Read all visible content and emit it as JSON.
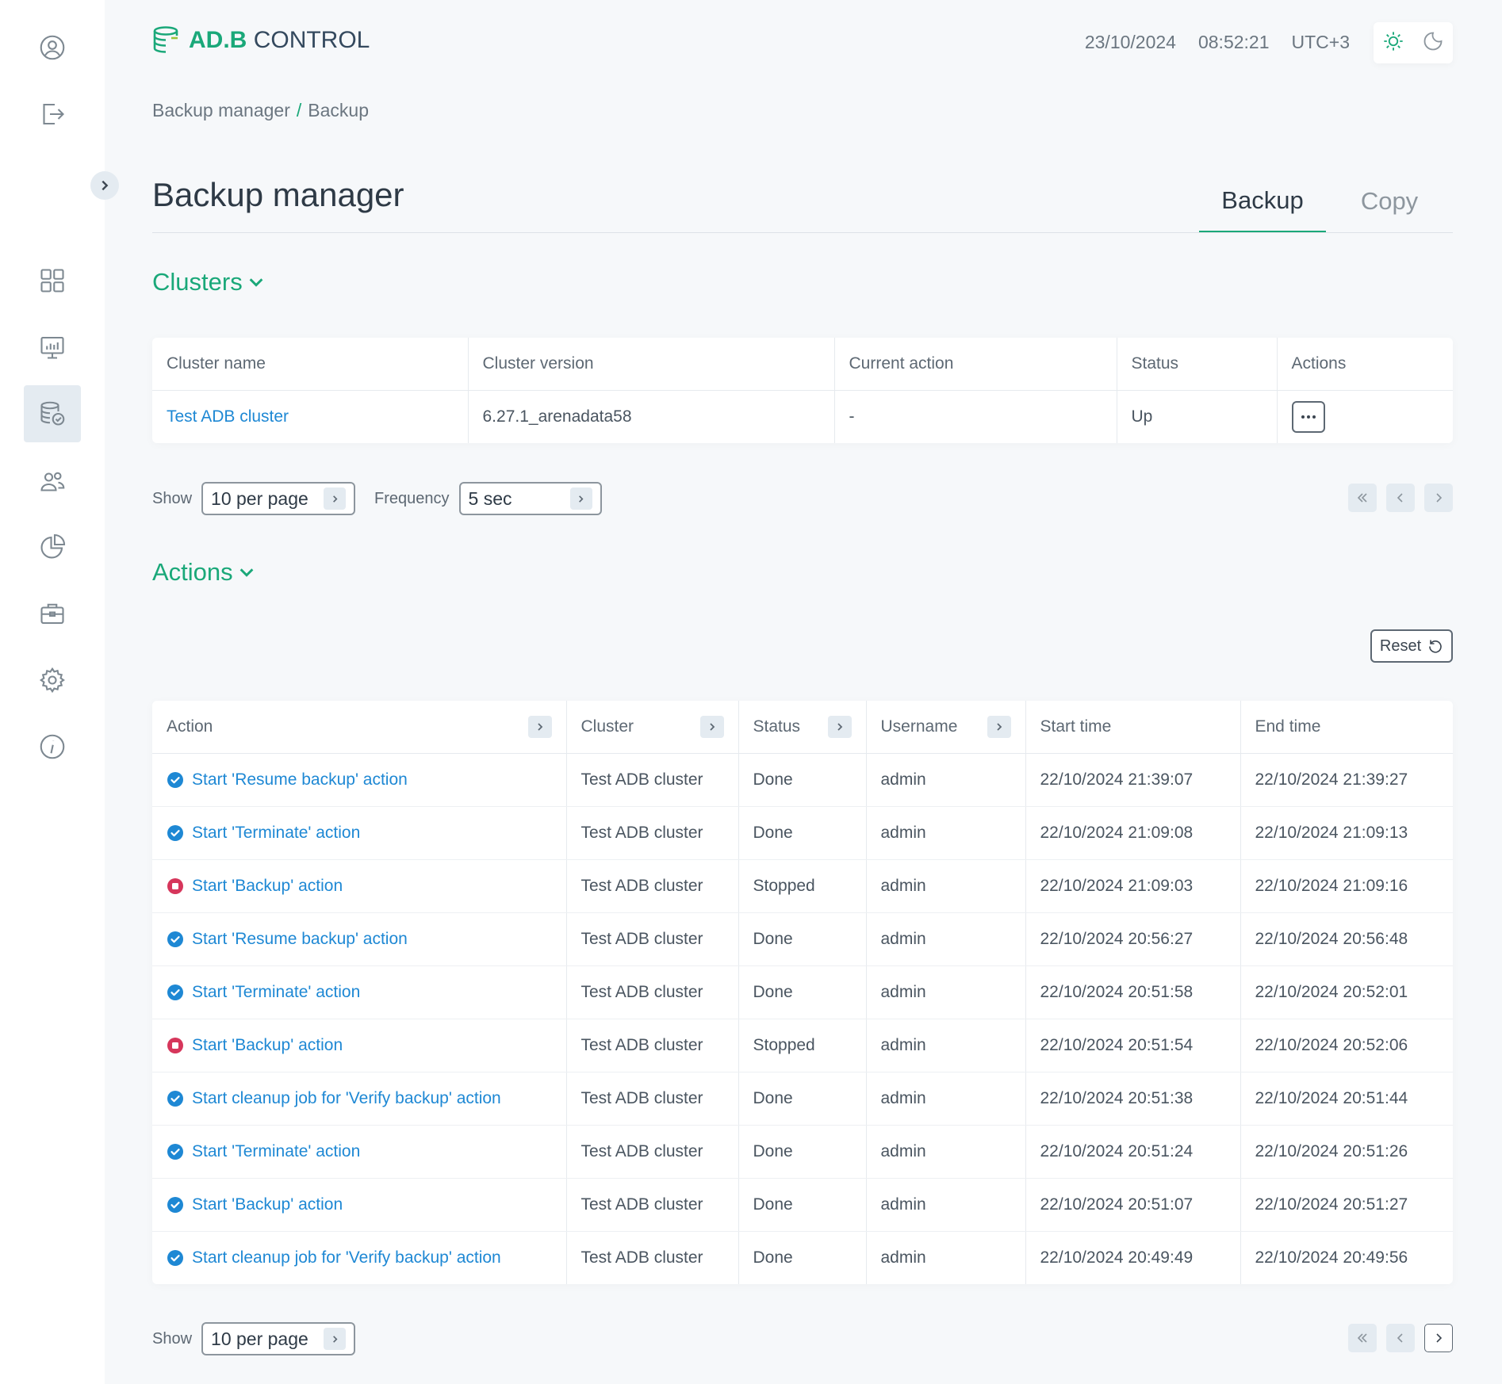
{
  "app": {
    "logo_brand": "AD.B",
    "logo_product": "CONTROL",
    "date": "23/10/2024",
    "time": "08:52:21",
    "timezone": "UTC+3"
  },
  "breadcrumb": {
    "parent": "Backup manager",
    "separator": "/",
    "current": "Backup"
  },
  "page": {
    "title": "Backup manager"
  },
  "tabs": [
    {
      "label": "Backup"
    },
    {
      "label": "Copy"
    }
  ],
  "clusters": {
    "title": "Clusters",
    "columns": [
      "Cluster name",
      "Cluster version",
      "Current action",
      "Status",
      "Actions"
    ],
    "rows": [
      {
        "name": "Test ADB cluster",
        "version": "6.27.1_arenadata58",
        "current_action": "-",
        "status": "Up"
      }
    ],
    "show_label": "Show",
    "per_page": "10 per page",
    "frequency_label": "Frequency",
    "frequency": "5 sec"
  },
  "actions": {
    "title": "Actions",
    "reset_label": "Reset",
    "columns": [
      "Action",
      "Cluster",
      "Status",
      "Username",
      "Start time",
      "End time"
    ],
    "rows": [
      {
        "action": "Start 'Resume backup' action",
        "cluster": "Test ADB cluster",
        "status": "Done",
        "username": "admin",
        "start": "22/10/2024 21:39:07",
        "end": "22/10/2024 21:39:27",
        "state": "done"
      },
      {
        "action": "Start 'Terminate' action",
        "cluster": "Test ADB cluster",
        "status": "Done",
        "username": "admin",
        "start": "22/10/2024 21:09:08",
        "end": "22/10/2024 21:09:13",
        "state": "done"
      },
      {
        "action": "Start 'Backup' action",
        "cluster": "Test ADB cluster",
        "status": "Stopped",
        "username": "admin",
        "start": "22/10/2024 21:09:03",
        "end": "22/10/2024 21:09:16",
        "state": "stopped"
      },
      {
        "action": "Start 'Resume backup' action",
        "cluster": "Test ADB cluster",
        "status": "Done",
        "username": "admin",
        "start": "22/10/2024 20:56:27",
        "end": "22/10/2024 20:56:48",
        "state": "done"
      },
      {
        "action": "Start 'Terminate' action",
        "cluster": "Test ADB cluster",
        "status": "Done",
        "username": "admin",
        "start": "22/10/2024 20:51:58",
        "end": "22/10/2024 20:52:01",
        "state": "done"
      },
      {
        "action": "Start 'Backup' action",
        "cluster": "Test ADB cluster",
        "status": "Stopped",
        "username": "admin",
        "start": "22/10/2024 20:51:54",
        "end": "22/10/2024 20:52:06",
        "state": "stopped"
      },
      {
        "action": "Start cleanup job for 'Verify backup' action",
        "cluster": "Test ADB cluster",
        "status": "Done",
        "username": "admin",
        "start": "22/10/2024 20:51:38",
        "end": "22/10/2024 20:51:44",
        "state": "done"
      },
      {
        "action": "Start 'Terminate' action",
        "cluster": "Test ADB cluster",
        "status": "Done",
        "username": "admin",
        "start": "22/10/2024 20:51:24",
        "end": "22/10/2024 20:51:26",
        "state": "done"
      },
      {
        "action": "Start 'Backup' action",
        "cluster": "Test ADB cluster",
        "status": "Done",
        "username": "admin",
        "start": "22/10/2024 20:51:07",
        "end": "22/10/2024 20:51:27",
        "state": "done"
      },
      {
        "action": "Start cleanup job for 'Verify backup' action",
        "cluster": "Test ADB cluster",
        "status": "Done",
        "username": "admin",
        "start": "22/10/2024 20:49:49",
        "end": "22/10/2024 20:49:56",
        "state": "done"
      }
    ],
    "show_label": "Show",
    "per_page": "10 per page"
  },
  "sidebar_icons": [
    "user-icon",
    "logout-icon",
    "dashboard-icon",
    "monitoring-icon",
    "backup-icon",
    "users-icon",
    "pie-chart-icon",
    "briefcase-icon",
    "settings-icon",
    "info-icon"
  ],
  "colors": {
    "accent": "#1aa879",
    "link": "#1e88d4",
    "done": "#1e88d4",
    "stopped": "#d6365b"
  }
}
